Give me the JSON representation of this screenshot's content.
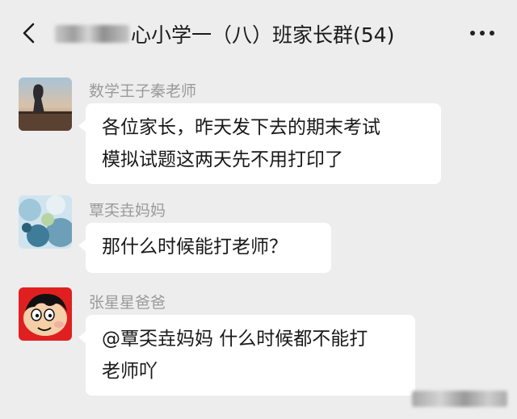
{
  "header": {
    "title": "心小学一（八）班家长群(54)"
  },
  "messages": [
    {
      "sender": "数学王子秦老师",
      "lines": [
        "各位家长，昨天发下去的期末考试",
        "模拟试题这两天先不用打印了"
      ]
    },
    {
      "sender": "覃奀垚妈妈",
      "lines": [
        "那什么时候能打老师？"
      ]
    },
    {
      "sender": "张星星爸爸",
      "lines": [
        "@覃奀垚妈妈 什么时候都不能打",
        "老师吖"
      ]
    }
  ],
  "icons": {
    "back": "chevron-left-icon",
    "more": "more-dots-icon"
  },
  "colors": {
    "background": "#ededed",
    "bubble": "#ffffff",
    "sender_text": "#9a9a9a"
  }
}
